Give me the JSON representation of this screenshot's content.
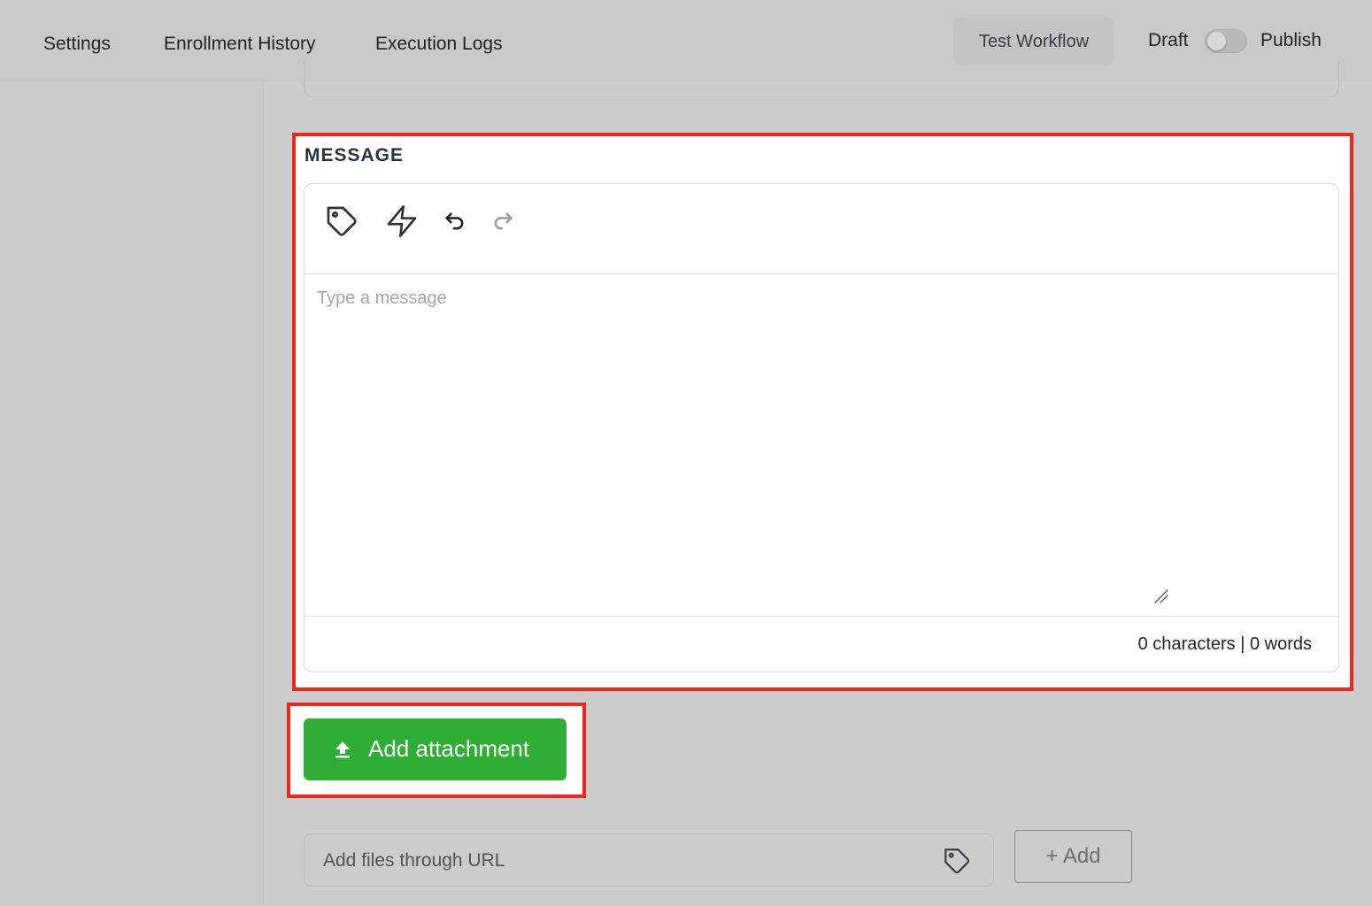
{
  "nav": {
    "settings": "Settings",
    "enrollment_history": "Enrollment History",
    "execution_logs": "Execution Logs"
  },
  "header": {
    "test_workflow": "Test Workflow",
    "draft": "Draft",
    "publish": "Publish",
    "publish_toggle_on": false
  },
  "message": {
    "label": "MESSAGE",
    "placeholder": "Type a message",
    "counter": "0 characters | 0 words",
    "toolbar_icons": [
      "tag-icon",
      "lightning-icon",
      "undo-icon",
      "redo-icon"
    ]
  },
  "attachment": {
    "button_label": "Add attachment",
    "icon": "upload-icon",
    "url_placeholder": "Add files through URL",
    "add_button": "+ Add"
  },
  "colors": {
    "highlight": "#f2261a",
    "primary_green": "#2eae35",
    "overlay_gray": "#cccccc"
  }
}
